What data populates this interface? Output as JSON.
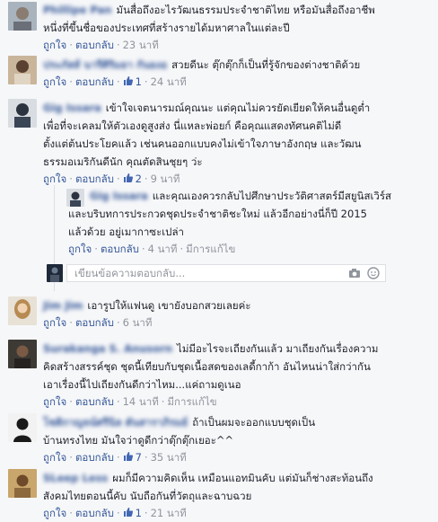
{
  "ui": {
    "reply_placeholder": "เขียนข้อความตอบกลับ...",
    "like_label": "ถูกใจ",
    "reply_label": "ตอบกลับ",
    "edited_label": "มีการแก้ไข"
  },
  "comments": [
    {
      "name": "Phillipe Pan",
      "text_lines": [
        "มันสื่อถึงอะไรวัฒนธรรมประจำชาติไทย หรือมันสื่อถึงอาชีพ",
        "หนึ่งที่ขึ้นชื่อของประเทศที่สร้างรายได้มหาศาลในแต่ละปี"
      ],
      "likes": "",
      "time": "23 นาที",
      "edited": false
    },
    {
      "name": "ประภัสส์ นารีศิริมยา กันยงอ",
      "text_lines": [
        "สวยดีนะ ตุ๊กตุ๊กก็เป็นที่รู้จักของต่างชาติด้วย"
      ],
      "likes": "1",
      "time": "24 นาที",
      "edited": false
    },
    {
      "name": "Gig Issara",
      "text_lines": [
        "เข้าใจเจตนารมณ์คุณนะ แต่คุณไม่ควรยัดเยียดให้คนอื่นดูต่ำ",
        "เพื่อที่จะเคลมให้ตัวเองดูสูงส่ง นี่แหละพ่อยก์ คือคุณแสดงทัศนคติไม่ดี",
        "ตั้งแต่ต้นประโยคแล้ว เช่นคนออกแบบคงไม่เข้าใจภาษาอังกฤษ และวัฒน",
        "ธรรมอเมริกันดีนัก คุณตัดสินชุยๆ ว่ะ"
      ],
      "likes": "2",
      "time": "9 นาที",
      "edited": false
    },
    {
      "name": "Gig Issara",
      "text_lines": [
        "และคุณเองควรกลับไปศึกษาประวัติศาสตร์มีสยูนิสเวิร์ส",
        "และบริบทการประกวดชุดประจำชาติชะใหม่ แล้วอีกอย่างนี่ก็ปี 2015",
        "แล้วด้วย อยู่เมากาซะเปล่า"
      ],
      "likes": "",
      "time": "4 นาที",
      "edited": true
    },
    {
      "name": "Jim Jim",
      "text_lines": [
        "เอารูปให้แฟนดู เขายังบอกสวยเลยค่ะ"
      ],
      "likes": "",
      "time": "6 นาที",
      "edited": false
    },
    {
      "name": "Surakanga S. Anusorn",
      "text_lines": [
        "ไม่มีอะไรจะเถียงกันแล้ว มาเถียงกันเรื่องความ",
        "คิดสร้างสรรค์ชุด ชุดนี้เทียบกับชุดเนื้อสดของเลดี้กาก้า อันไหนน่าใส่กว่ากัน",
        "เอาเรื่องนี้ไปเถียงกันดีกว่าไหม...แค่ถามดูเนอ"
      ],
      "likes": "",
      "time": "14 นาที",
      "edited": true
    },
    {
      "name": "โชติกาญจน์ศรีนิล ตันสาราภิรมย์",
      "text_lines": [
        "ถ้าเป็นผมจะออกแบบชุดเป็น",
        "บ้านทรงไทย มันใจว่าดูดีกว่าตุ๊กตุ๊กเยอะ^^"
      ],
      "likes": "7",
      "time": "35 นาที",
      "edited": false
    },
    {
      "name": "SLeep Less",
      "text_lines": [
        "ผมก็มีความคิดเห็น เหมือนแอทมินคับ แต่มันก็ช่างสะท้อนถึง",
        "สังคมไทยตอนนี้คับ นับถือกันที่วัตถุและฉาบฉวย"
      ],
      "likes": "1",
      "time": "21 นาที",
      "edited": false
    }
  ]
}
